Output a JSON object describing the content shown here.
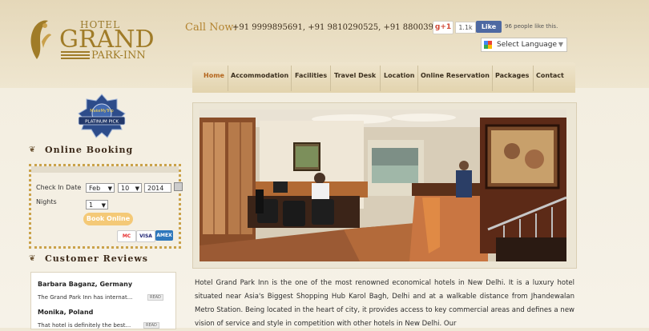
{
  "logo": {
    "hotel": "HOTEL",
    "grand": "GRAND",
    "park_inn": "PARK-INN"
  },
  "contact": {
    "call_label": "Call Now:",
    "phones": "+91 9999895691, +91 9810290525, +91 8800390970"
  },
  "social": {
    "gplus_label": "g+1",
    "gplus_count": "1.1k",
    "fb_like_label": "Like",
    "fb_text": "96 people like this."
  },
  "language": {
    "label": "Select Language",
    "arrow": "▼"
  },
  "nav": {
    "items": [
      {
        "label": "Home",
        "active": true
      },
      {
        "label": "Accommodation"
      },
      {
        "label": "Facilities"
      },
      {
        "label": "Travel Desk"
      },
      {
        "label": "Location"
      },
      {
        "label": "Online Reservation"
      },
      {
        "label": "Packages"
      },
      {
        "label": "Contact"
      }
    ]
  },
  "badge": {
    "text_top": "MakeMyTrip",
    "text_bottom": "PLATINUM PICK"
  },
  "booking": {
    "title": "Online Booking",
    "check_in_label": "Check In Date",
    "month": "Feb",
    "day": "10",
    "year": "2014",
    "nights_label": "Nights",
    "nights": "1",
    "button": "Book Online",
    "cards": [
      "MC",
      "VISA",
      "AMEX"
    ]
  },
  "reviews": {
    "title": "Customer Reviews",
    "items": [
      {
        "name": "Barbara Baganz, Germany",
        "text": "The Grand Park Inn has internat...",
        "read": "READ"
      },
      {
        "name": "Monika, Poland",
        "text": "That hotel is definitely the best...",
        "read": "READ"
      }
    ]
  },
  "description": "Hotel Grand Park Inn is the one of the most renowned economical hotels in New Delhi. It is a luxury hotel situated near Asia's Biggest Shopping Hub Karol Bagh, Delhi and at a walkable distance from Jhandewalan Metro Station. Being located in the heart of city, it provides access to key commercial areas and defines a new vision of service and style in competition with other hotels in New Delhi. Our",
  "colors": {
    "accent_gold": "#a07c28",
    "nav_active": "#b4651c",
    "button": "#f4c977"
  }
}
